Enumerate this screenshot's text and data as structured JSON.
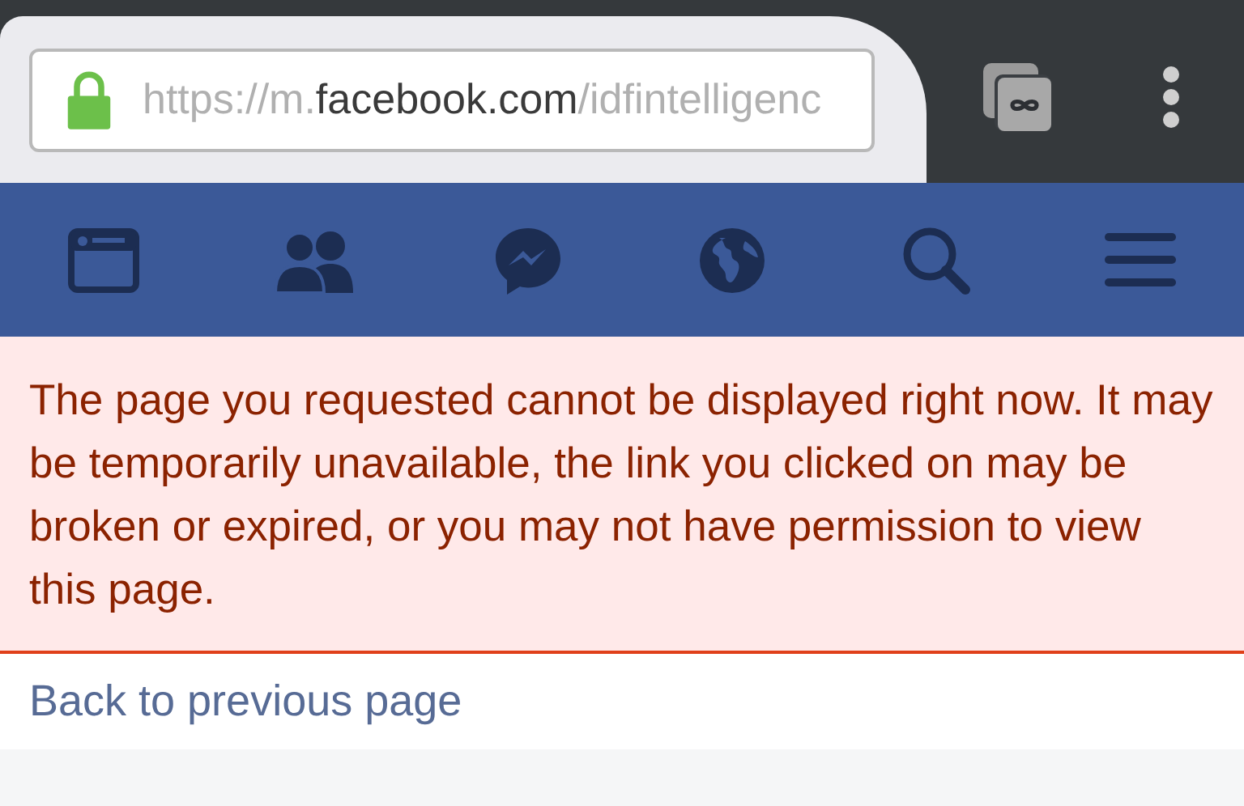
{
  "browser": {
    "url": {
      "scheme": "https://m.",
      "domain": "facebook.com",
      "path": "/idfintelligenc"
    },
    "secure": true
  },
  "error": {
    "message": "The page you requested cannot be displayed right now. It may be temporarily unavailable, the link you clicked on may be broken or expired, or you may not have permission to view this page."
  },
  "back_link": "Back to previous page"
}
